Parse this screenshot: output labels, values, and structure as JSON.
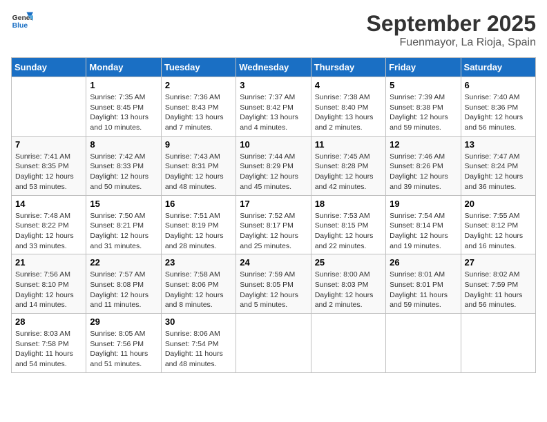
{
  "header": {
    "logo_line1": "General",
    "logo_line2": "Blue",
    "month": "September 2025",
    "location": "Fuenmayor, La Rioja, Spain"
  },
  "days_of_week": [
    "Sunday",
    "Monday",
    "Tuesday",
    "Wednesday",
    "Thursday",
    "Friday",
    "Saturday"
  ],
  "weeks": [
    [
      {
        "day": "",
        "info": ""
      },
      {
        "day": "1",
        "info": "Sunrise: 7:35 AM\nSunset: 8:45 PM\nDaylight: 13 hours\nand 10 minutes."
      },
      {
        "day": "2",
        "info": "Sunrise: 7:36 AM\nSunset: 8:43 PM\nDaylight: 13 hours\nand 7 minutes."
      },
      {
        "day": "3",
        "info": "Sunrise: 7:37 AM\nSunset: 8:42 PM\nDaylight: 13 hours\nand 4 minutes."
      },
      {
        "day": "4",
        "info": "Sunrise: 7:38 AM\nSunset: 8:40 PM\nDaylight: 13 hours\nand 2 minutes."
      },
      {
        "day": "5",
        "info": "Sunrise: 7:39 AM\nSunset: 8:38 PM\nDaylight: 12 hours\nand 59 minutes."
      },
      {
        "day": "6",
        "info": "Sunrise: 7:40 AM\nSunset: 8:36 PM\nDaylight: 12 hours\nand 56 minutes."
      }
    ],
    [
      {
        "day": "7",
        "info": "Sunrise: 7:41 AM\nSunset: 8:35 PM\nDaylight: 12 hours\nand 53 minutes."
      },
      {
        "day": "8",
        "info": "Sunrise: 7:42 AM\nSunset: 8:33 PM\nDaylight: 12 hours\nand 50 minutes."
      },
      {
        "day": "9",
        "info": "Sunrise: 7:43 AM\nSunset: 8:31 PM\nDaylight: 12 hours\nand 48 minutes."
      },
      {
        "day": "10",
        "info": "Sunrise: 7:44 AM\nSunset: 8:29 PM\nDaylight: 12 hours\nand 45 minutes."
      },
      {
        "day": "11",
        "info": "Sunrise: 7:45 AM\nSunset: 8:28 PM\nDaylight: 12 hours\nand 42 minutes."
      },
      {
        "day": "12",
        "info": "Sunrise: 7:46 AM\nSunset: 8:26 PM\nDaylight: 12 hours\nand 39 minutes."
      },
      {
        "day": "13",
        "info": "Sunrise: 7:47 AM\nSunset: 8:24 PM\nDaylight: 12 hours\nand 36 minutes."
      }
    ],
    [
      {
        "day": "14",
        "info": "Sunrise: 7:48 AM\nSunset: 8:22 PM\nDaylight: 12 hours\nand 33 minutes."
      },
      {
        "day": "15",
        "info": "Sunrise: 7:50 AM\nSunset: 8:21 PM\nDaylight: 12 hours\nand 31 minutes."
      },
      {
        "day": "16",
        "info": "Sunrise: 7:51 AM\nSunset: 8:19 PM\nDaylight: 12 hours\nand 28 minutes."
      },
      {
        "day": "17",
        "info": "Sunrise: 7:52 AM\nSunset: 8:17 PM\nDaylight: 12 hours\nand 25 minutes."
      },
      {
        "day": "18",
        "info": "Sunrise: 7:53 AM\nSunset: 8:15 PM\nDaylight: 12 hours\nand 22 minutes."
      },
      {
        "day": "19",
        "info": "Sunrise: 7:54 AM\nSunset: 8:14 PM\nDaylight: 12 hours\nand 19 minutes."
      },
      {
        "day": "20",
        "info": "Sunrise: 7:55 AM\nSunset: 8:12 PM\nDaylight: 12 hours\nand 16 minutes."
      }
    ],
    [
      {
        "day": "21",
        "info": "Sunrise: 7:56 AM\nSunset: 8:10 PM\nDaylight: 12 hours\nand 14 minutes."
      },
      {
        "day": "22",
        "info": "Sunrise: 7:57 AM\nSunset: 8:08 PM\nDaylight: 12 hours\nand 11 minutes."
      },
      {
        "day": "23",
        "info": "Sunrise: 7:58 AM\nSunset: 8:06 PM\nDaylight: 12 hours\nand 8 minutes."
      },
      {
        "day": "24",
        "info": "Sunrise: 7:59 AM\nSunset: 8:05 PM\nDaylight: 12 hours\nand 5 minutes."
      },
      {
        "day": "25",
        "info": "Sunrise: 8:00 AM\nSunset: 8:03 PM\nDaylight: 12 hours\nand 2 minutes."
      },
      {
        "day": "26",
        "info": "Sunrise: 8:01 AM\nSunset: 8:01 PM\nDaylight: 11 hours\nand 59 minutes."
      },
      {
        "day": "27",
        "info": "Sunrise: 8:02 AM\nSunset: 7:59 PM\nDaylight: 11 hours\nand 56 minutes."
      }
    ],
    [
      {
        "day": "28",
        "info": "Sunrise: 8:03 AM\nSunset: 7:58 PM\nDaylight: 11 hours\nand 54 minutes."
      },
      {
        "day": "29",
        "info": "Sunrise: 8:05 AM\nSunset: 7:56 PM\nDaylight: 11 hours\nand 51 minutes."
      },
      {
        "day": "30",
        "info": "Sunrise: 8:06 AM\nSunset: 7:54 PM\nDaylight: 11 hours\nand 48 minutes."
      },
      {
        "day": "",
        "info": ""
      },
      {
        "day": "",
        "info": ""
      },
      {
        "day": "",
        "info": ""
      },
      {
        "day": "",
        "info": ""
      }
    ]
  ]
}
